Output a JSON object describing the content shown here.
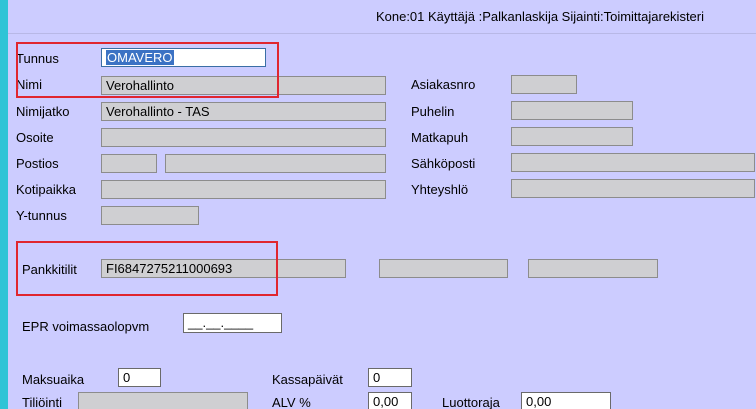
{
  "title_bar": {
    "text": "Kone:01 Käyttäjä :Palkanlaskija  Sijainti:Toimittajarekisteri"
  },
  "form": {
    "tunnus": {
      "label": "Tunnus",
      "value": "OMAVERO"
    },
    "nimi": {
      "label": "Nimi",
      "value": "Verohallinto"
    },
    "nimijatko": {
      "label": "Nimijatko",
      "value": "Verohallinto - TAS"
    },
    "osoite": {
      "label": "Osoite",
      "value": ""
    },
    "postios": {
      "label": "Postios",
      "value_1": "",
      "value_2": ""
    },
    "kotipaikka": {
      "label": "Kotipaikka",
      "value": ""
    },
    "ytunnus": {
      "label": "Y-tunnus",
      "value": ""
    },
    "asiakasnro": {
      "label": "Asiakasnro",
      "value": ""
    },
    "puhelin": {
      "label": "Puhelin",
      "value": ""
    },
    "matkapuh": {
      "label": "Matkapuh",
      "value": ""
    },
    "sahkoposti": {
      "label": "Sähköposti",
      "value": ""
    },
    "yhteyshlo": {
      "label": "Yhteyshlö",
      "value": ""
    },
    "pankkitilit": {
      "label": "Pankkitilit",
      "value_1": "FI6847275211000693",
      "value_2": "",
      "value_3": ""
    },
    "epr": {
      "label": "EPR voimassaolopvm",
      "value": "__.__.____"
    },
    "maksuaika": {
      "label": "Maksuaika",
      "value": "0"
    },
    "kassapaivat": {
      "label": "Kassapäivät",
      "value": "0"
    },
    "tiliointi": {
      "label": "Tiliöinti",
      "value": ""
    },
    "alv": {
      "label": "ALV %",
      "value": "0,00"
    },
    "luottoraja": {
      "label": "Luottoraja",
      "value": "0,00"
    }
  },
  "colors": {
    "background": "#ccccff",
    "accent": "#2fc4d6",
    "highlight": "#e0262f",
    "selection": "#3b72c4"
  }
}
